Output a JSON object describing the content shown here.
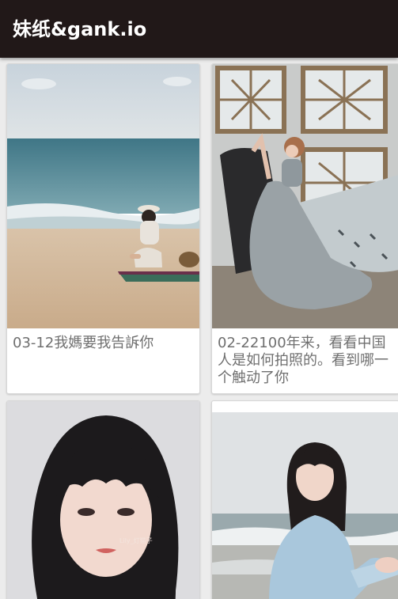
{
  "app": {
    "title": "妹纸&gank.io"
  },
  "cards": [
    {
      "caption": "03-12我媽要我告訴你",
      "image": "beach-photo"
    },
    {
      "caption": "02-22100年来，看看中国人是如何拍照的。看到哪一个触动了你",
      "image": "gown-photo"
    },
    {
      "caption": "",
      "image": "portrait-photo",
      "watermark": "Lily_灯猫子"
    },
    {
      "caption": "",
      "image": "seaside-photo"
    }
  ]
}
